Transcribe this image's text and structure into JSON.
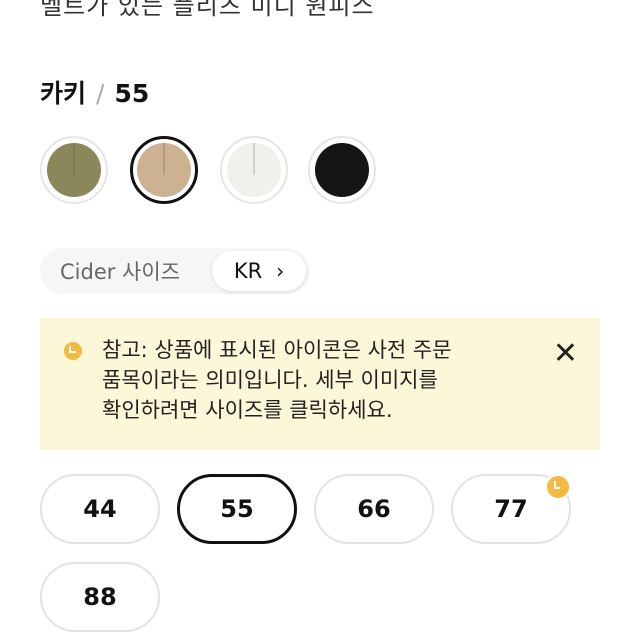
{
  "product": {
    "title_partial": "벨트가 있는 플리츠 미디 원피스"
  },
  "selection": {
    "color": "카키",
    "separator": "/",
    "size": "55"
  },
  "swatches": [
    {
      "name": "olive",
      "color": "#8c875a",
      "selected": false
    },
    {
      "name": "beige",
      "color": "#cdb291",
      "selected": true
    },
    {
      "name": "ivory",
      "color": "#f2f0ea",
      "selected": false
    },
    {
      "name": "black",
      "color": "#151515",
      "selected": false
    }
  ],
  "size_system": {
    "label": "Cider 사이즈",
    "value": "KR",
    "chevron": "›"
  },
  "notice": {
    "lines": [
      "참고: 상품에 표시된 아이콘은 사전 주문",
      "품목이라는 의미입니다. 세부 이미지를",
      "확인하려면 사이즈를 클릭하세요."
    ],
    "close": "✕"
  },
  "sizes": [
    {
      "label": "44",
      "selected": false,
      "preorder": false
    },
    {
      "label": "55",
      "selected": true,
      "preorder": false
    },
    {
      "label": "66",
      "selected": false,
      "preorder": false
    },
    {
      "label": "77",
      "selected": false,
      "preorder": true
    },
    {
      "label": "88",
      "selected": false,
      "preorder": false
    }
  ]
}
